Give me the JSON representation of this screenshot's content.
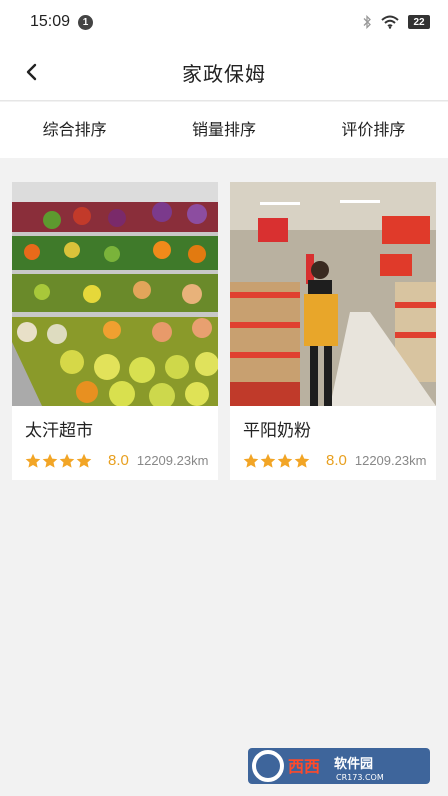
{
  "status_bar": {
    "time": "15:09",
    "notification_count": "1",
    "battery": "22",
    "icons": [
      "bluetooth-icon",
      "wifi-icon",
      "battery-icon"
    ]
  },
  "header": {
    "title": "家政保姆",
    "back_icon": "chevron-left-icon"
  },
  "sort_tabs": [
    {
      "label": "综合排序"
    },
    {
      "label": "销量排序"
    },
    {
      "label": "评价排序"
    }
  ],
  "cards": [
    {
      "name": "太汗超市",
      "stars": 4,
      "rating": "8.0",
      "distance": "12209.23km",
      "image": "supermarket-fruit-shelves-photo"
    },
    {
      "name": "平阳奶粉",
      "stars": 4,
      "rating": "8.0",
      "distance": "12209.23km",
      "image": "supermarket-aisle-staff-photo"
    }
  ],
  "colors": {
    "star": "#f2a526",
    "rating": "#e8a020",
    "background": "#f2f2f2"
  },
  "watermark": {
    "brand": "西西软件园",
    "domain": "CR173.COM"
  }
}
